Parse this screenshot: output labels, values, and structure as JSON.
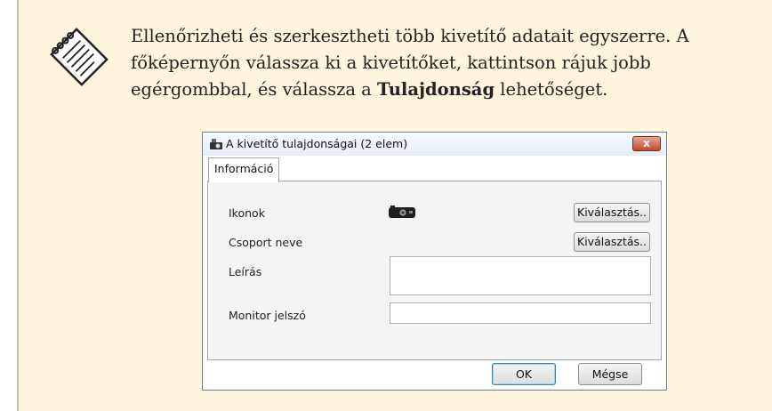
{
  "note": {
    "icon": "note-pad-icon",
    "text_lines": [
      "Ellenőrizheti és szerkesztheti több kivetítő adatait egyszerre. A",
      "főképernyőn válassza ki a kivetítőket, kattintson rájuk jobb",
      "egérgombbal, és válassza a "
    ],
    "bold_term": "Tulajdonság",
    "text_end": " lehetőséget."
  },
  "dialog": {
    "title": "A kivetítő tulajdonságai (2 elem)",
    "close_label": "x",
    "tab_label": "Információ",
    "rows": {
      "icons_label": "Ikonok",
      "group_label": "Csoport neve",
      "description_label": "Leírás",
      "monitor_password_label": "Monitor jelszó"
    },
    "select_label": "Kiválasztás..",
    "description_value": "",
    "monitor_password_value": "",
    "ok_label": "OK",
    "cancel_label": "Mégse"
  }
}
